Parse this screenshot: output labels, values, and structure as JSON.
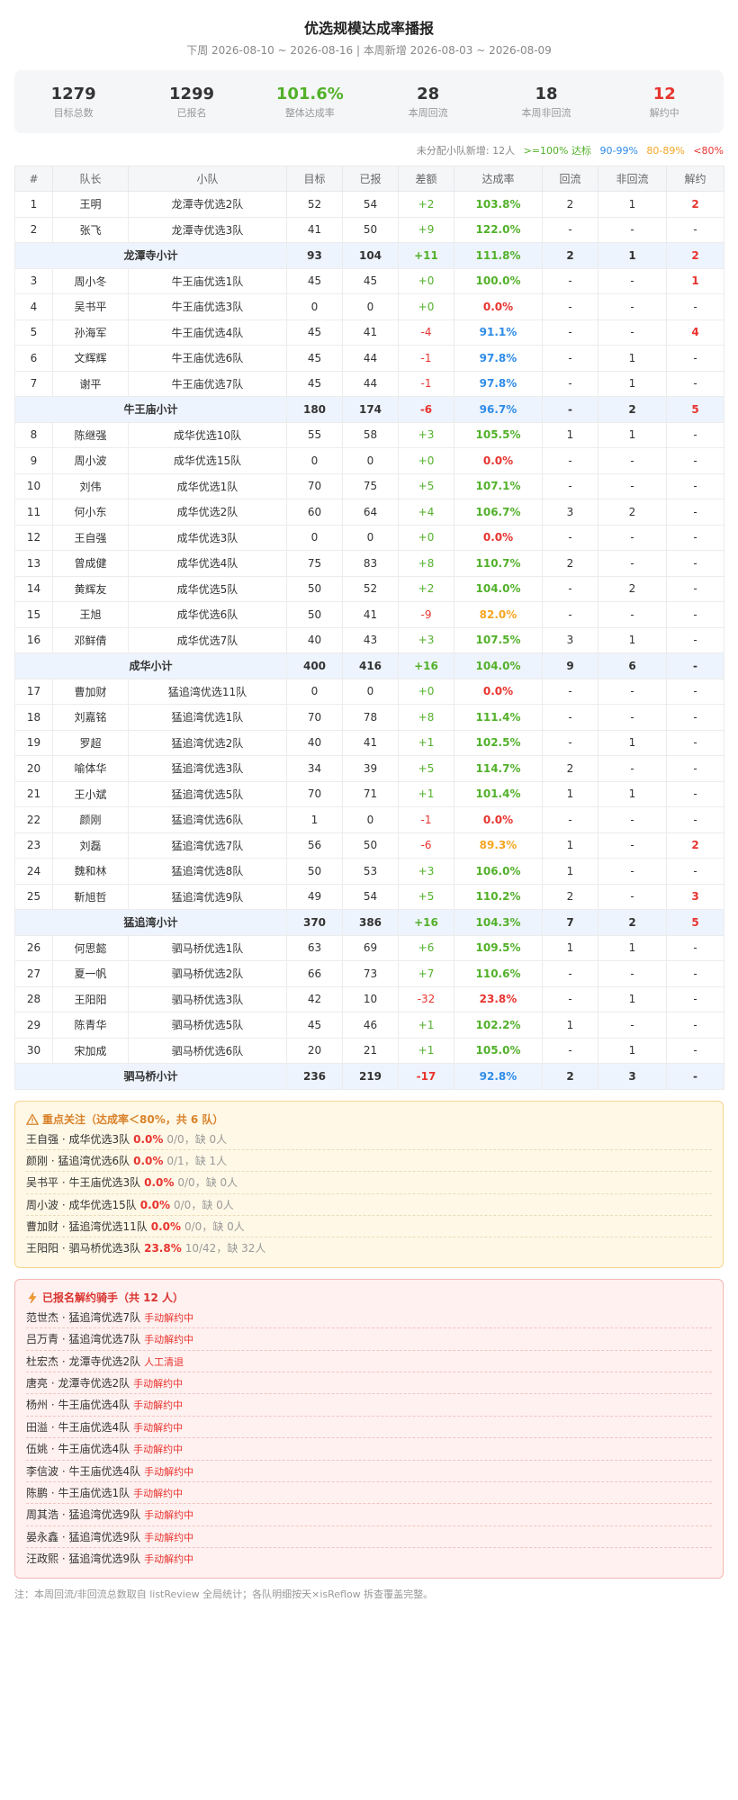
{
  "header": {
    "title": "优选规模达成率播报",
    "subtitle": "下周 2026-08-10 ~ 2026-08-16 | 本周新增 2026-08-03 ~ 2026-08-09"
  },
  "summary": [
    {
      "value": "1279",
      "label": "目标总数",
      "color": "#333333"
    },
    {
      "value": "1299",
      "label": "已报名",
      "color": "#333333"
    },
    {
      "value": "101.6%",
      "label": "整体达成率",
      "color": "#52b12a"
    },
    {
      "value": "28",
      "label": "本周回流",
      "color": "#333333"
    },
    {
      "value": "18",
      "label": "本周非回流",
      "color": "#333333"
    },
    {
      "value": "12",
      "label": "解约中",
      "color": "#e8342f"
    }
  ],
  "legend": {
    "unassigned": "未分配小队新增: 12人",
    "green": ">=100% 达标",
    "blue": "90-99%",
    "orange": "80-89%",
    "red": "<80%"
  },
  "table": {
    "headers": [
      "#",
      "队长",
      "小队",
      "目标",
      "已报",
      "差额",
      "达成率",
      "回流",
      "非回流",
      "解约"
    ],
    "rows": [
      {
        "type": "row",
        "cells": [
          "1",
          "王明",
          "龙潭寺优选2队",
          "52",
          "54",
          "+2",
          "103.8%",
          "2",
          "1",
          "2"
        ]
      },
      {
        "type": "row",
        "cells": [
          "2",
          "张飞",
          "龙潭寺优选3队",
          "41",
          "50",
          "+9",
          "122.0%",
          "-",
          "-",
          "-"
        ]
      },
      {
        "type": "sub",
        "cells": [
          "",
          "",
          "龙潭寺小计",
          "93",
          "104",
          "+11",
          "111.8%",
          "2",
          "1",
          "2"
        ]
      },
      {
        "type": "row",
        "cells": [
          "3",
          "周小冬",
          "牛王庙优选1队",
          "45",
          "45",
          "+0",
          "100.0%",
          "-",
          "-",
          "1"
        ]
      },
      {
        "type": "row",
        "cells": [
          "4",
          "吴书平",
          "牛王庙优选3队",
          "0",
          "0",
          "+0",
          "0.0%",
          "-",
          "-",
          "-"
        ]
      },
      {
        "type": "row",
        "cells": [
          "5",
          "孙海军",
          "牛王庙优选4队",
          "45",
          "41",
          "-4",
          "91.1%",
          "-",
          "-",
          "4"
        ]
      },
      {
        "type": "row",
        "cells": [
          "6",
          "文辉辉",
          "牛王庙优选6队",
          "45",
          "44",
          "-1",
          "97.8%",
          "-",
          "1",
          "-"
        ]
      },
      {
        "type": "row",
        "cells": [
          "7",
          "谢平",
          "牛王庙优选7队",
          "45",
          "44",
          "-1",
          "97.8%",
          "-",
          "1",
          "-"
        ]
      },
      {
        "type": "sub",
        "cells": [
          "",
          "",
          "牛王庙小计",
          "180",
          "174",
          "-6",
          "96.7%",
          "-",
          "2",
          "5"
        ]
      },
      {
        "type": "row",
        "cells": [
          "8",
          "陈继强",
          "成华优选10队",
          "55",
          "58",
          "+3",
          "105.5%",
          "1",
          "1",
          "-"
        ]
      },
      {
        "type": "row",
        "cells": [
          "9",
          "周小波",
          "成华优选15队",
          "0",
          "0",
          "+0",
          "0.0%",
          "-",
          "-",
          "-"
        ]
      },
      {
        "type": "row",
        "cells": [
          "10",
          "刘伟",
          "成华优选1队",
          "70",
          "75",
          "+5",
          "107.1%",
          "-",
          "-",
          "-"
        ]
      },
      {
        "type": "row",
        "cells": [
          "11",
          "何小东",
          "成华优选2队",
          "60",
          "64",
          "+4",
          "106.7%",
          "3",
          "2",
          "-"
        ]
      },
      {
        "type": "row",
        "cells": [
          "12",
          "王自强",
          "成华优选3队",
          "0",
          "0",
          "+0",
          "0.0%",
          "-",
          "-",
          "-"
        ]
      },
      {
        "type": "row",
        "cells": [
          "13",
          "曾成健",
          "成华优选4队",
          "75",
          "83",
          "+8",
          "110.7%",
          "2",
          "-",
          "-"
        ]
      },
      {
        "type": "row",
        "cells": [
          "14",
          "黄辉友",
          "成华优选5队",
          "50",
          "52",
          "+2",
          "104.0%",
          "-",
          "2",
          "-"
        ]
      },
      {
        "type": "row",
        "cells": [
          "15",
          "王旭",
          "成华优选6队",
          "50",
          "41",
          "-9",
          "82.0%",
          "-",
          "-",
          "-"
        ]
      },
      {
        "type": "row",
        "cells": [
          "16",
          "邓鲜倩",
          "成华优选7队",
          "40",
          "43",
          "+3",
          "107.5%",
          "3",
          "1",
          "-"
        ]
      },
      {
        "type": "sub",
        "cells": [
          "",
          "",
          "成华小计",
          "400",
          "416",
          "+16",
          "104.0%",
          "9",
          "6",
          "-"
        ]
      },
      {
        "type": "row",
        "cells": [
          "17",
          "曹加财",
          "猛追湾优选11队",
          "0",
          "0",
          "+0",
          "0.0%",
          "-",
          "-",
          "-"
        ]
      },
      {
        "type": "row",
        "cells": [
          "18",
          "刘嘉铭",
          "猛追湾优选1队",
          "70",
          "78",
          "+8",
          "111.4%",
          "-",
          "-",
          "-"
        ]
      },
      {
        "type": "row",
        "cells": [
          "19",
          "罗超",
          "猛追湾优选2队",
          "40",
          "41",
          "+1",
          "102.5%",
          "-",
          "1",
          "-"
        ]
      },
      {
        "type": "row",
        "cells": [
          "20",
          "喻体华",
          "猛追湾优选3队",
          "34",
          "39",
          "+5",
          "114.7%",
          "2",
          "-",
          "-"
        ]
      },
      {
        "type": "row",
        "cells": [
          "21",
          "王小斌",
          "猛追湾优选5队",
          "70",
          "71",
          "+1",
          "101.4%",
          "1",
          "1",
          "-"
        ]
      },
      {
        "type": "row",
        "cells": [
          "22",
          "颜刚",
          "猛追湾优选6队",
          "1",
          "0",
          "-1",
          "0.0%",
          "-",
          "-",
          "-"
        ]
      },
      {
        "type": "row",
        "cells": [
          "23",
          "刘磊",
          "猛追湾优选7队",
          "56",
          "50",
          "-6",
          "89.3%",
          "1",
          "-",
          "2"
        ]
      },
      {
        "type": "row",
        "cells": [
          "24",
          "魏和林",
          "猛追湾优选8队",
          "50",
          "53",
          "+3",
          "106.0%",
          "1",
          "-",
          "-"
        ]
      },
      {
        "type": "row",
        "cells": [
          "25",
          "靳旭哲",
          "猛追湾优选9队",
          "49",
          "54",
          "+5",
          "110.2%",
          "2",
          "-",
          "3"
        ]
      },
      {
        "type": "sub",
        "cells": [
          "",
          "",
          "猛追湾小计",
          "370",
          "386",
          "+16",
          "104.3%",
          "7",
          "2",
          "5"
        ]
      },
      {
        "type": "row",
        "cells": [
          "26",
          "何思懿",
          "驷马桥优选1队",
          "63",
          "69",
          "+6",
          "109.5%",
          "1",
          "1",
          "-"
        ]
      },
      {
        "type": "row",
        "cells": [
          "27",
          "夏一帆",
          "驷马桥优选2队",
          "66",
          "73",
          "+7",
          "110.6%",
          "-",
          "-",
          "-"
        ]
      },
      {
        "type": "row",
        "cells": [
          "28",
          "王阳阳",
          "驷马桥优选3队",
          "42",
          "10",
          "-32",
          "23.8%",
          "-",
          "1",
          "-"
        ]
      },
      {
        "type": "row",
        "cells": [
          "29",
          "陈青华",
          "驷马桥优选5队",
          "45",
          "46",
          "+1",
          "102.2%",
          "1",
          "-",
          "-"
        ]
      },
      {
        "type": "row",
        "cells": [
          "30",
          "宋加成",
          "驷马桥优选6队",
          "20",
          "21",
          "+1",
          "105.0%",
          "-",
          "1",
          "-"
        ]
      },
      {
        "type": "sub",
        "cells": [
          "",
          "",
          "驷马桥小计",
          "236",
          "219",
          "-17",
          "92.8%",
          "2",
          "3",
          "-"
        ]
      }
    ]
  },
  "focus": {
    "title": "重点关注（达成率＜80%，共 6 队）",
    "icon": "warning-icon",
    "items": [
      {
        "name": "王自强 · 成华优选3队",
        "rate": "0.0%",
        "detail": "0/0，缺 0人"
      },
      {
        "name": "颜刚 · 猛追湾优选6队",
        "rate": "0.0%",
        "detail": "0/1，缺 1人"
      },
      {
        "name": "吴书平 · 牛王庙优选3队",
        "rate": "0.0%",
        "detail": "0/0，缺 0人"
      },
      {
        "name": "周小波 · 成华优选15队",
        "rate": "0.0%",
        "detail": "0/0，缺 0人"
      },
      {
        "name": "曹加财 · 猛追湾优选11队",
        "rate": "0.0%",
        "detail": "0/0，缺 0人"
      },
      {
        "name": "王阳阳 · 驷马桥优选3队",
        "rate": "23.8%",
        "detail": "10/42，缺 32人"
      }
    ]
  },
  "cancel": {
    "title": "已报名解约骑手（共 12 人）",
    "icon": "lightning-icon",
    "items": [
      {
        "name": "范世杰 · 猛追湾优选7队",
        "status": "手动解约中"
      },
      {
        "name": "吕万青 · 猛追湾优选7队",
        "status": "手动解约中"
      },
      {
        "name": "杜宏杰 · 龙潭寺优选2队",
        "status": "人工清退"
      },
      {
        "name": "唐亮 · 龙潭寺优选2队",
        "status": "手动解约中"
      },
      {
        "name": "杨州 · 牛王庙优选4队",
        "status": "手动解约中"
      },
      {
        "name": "田溢 · 牛王庙优选4队",
        "status": "手动解约中"
      },
      {
        "name": "伍姚 · 牛王庙优选4队",
        "status": "手动解约中"
      },
      {
        "name": "李信波 · 牛王庙优选4队",
        "status": "手动解约中"
      },
      {
        "name": "陈鹏 · 牛王庙优选1队",
        "status": "手动解约中"
      },
      {
        "name": "周其浩 · 猛追湾优选9队",
        "status": "手动解约中"
      },
      {
        "name": "晏永鑫 · 猛追湾优选9队",
        "status": "手动解约中"
      },
      {
        "name": "汪政熙 · 猛追湾优选9队",
        "status": "手动解约中"
      }
    ]
  },
  "footer": "注：本周回流/非回流总数取自 listReview 全局统计；各队明细按天×isReflow 拆查覆盖完整。",
  "colors": {
    "green": "#52b12a",
    "blue": "#2f8ce8",
    "orange": "#f5a623",
    "red": "#e8342f",
    "subtotal_bg": "#eef4fd"
  }
}
